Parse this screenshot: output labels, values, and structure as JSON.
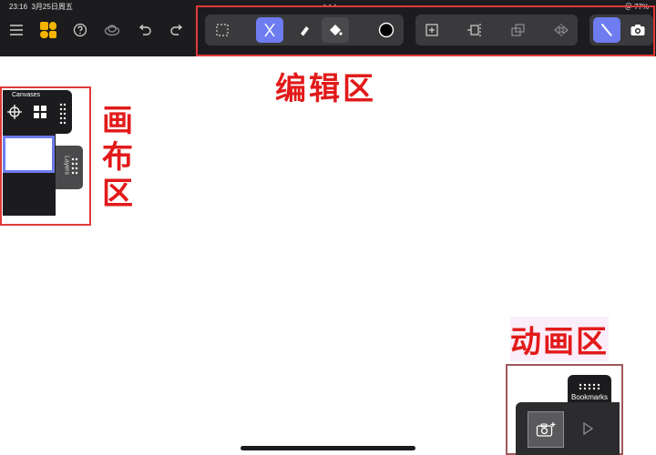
{
  "status_bar": {
    "time": "23:16",
    "date": "3月25日周五",
    "right": "＠ 77%"
  },
  "toolbar": {
    "left_tools": [
      "menu-icon",
      "logo-icon",
      "help-icon",
      "onion-skin-icon",
      "undo-icon",
      "redo-icon"
    ],
    "draw_group": [
      "selection-icon",
      "pen-icon",
      "eraser-icon",
      "fill-bucket-icon",
      "color-swatch-icon"
    ],
    "frame_group": [
      "add-frame-icon",
      "move-frame-icon",
      "duplicate-frame-icon",
      "mirror-frame-icon"
    ],
    "right_tools": [
      "pencil-icon",
      "camera-icon"
    ],
    "colors": {
      "bar": "#1c1c1e",
      "group": "#3a3a3c",
      "active": "#6e7cf0",
      "swatch": "#000000"
    }
  },
  "annotations": {
    "edit_area": "编辑区",
    "canvas_area": [
      "画",
      "布",
      "区"
    ],
    "animation_area": "动画区",
    "color": "#e21a1a"
  },
  "canvases_panel": {
    "title": "Canvases",
    "tools": [
      "crosshair-icon",
      "grid-icon",
      "drag-handle-icon"
    ],
    "layers_label": "Layers"
  },
  "animation_panel": {
    "bookmarks_label": "Bookmarks",
    "tools": [
      "add-frame-camera-icon",
      "play-icon"
    ]
  }
}
